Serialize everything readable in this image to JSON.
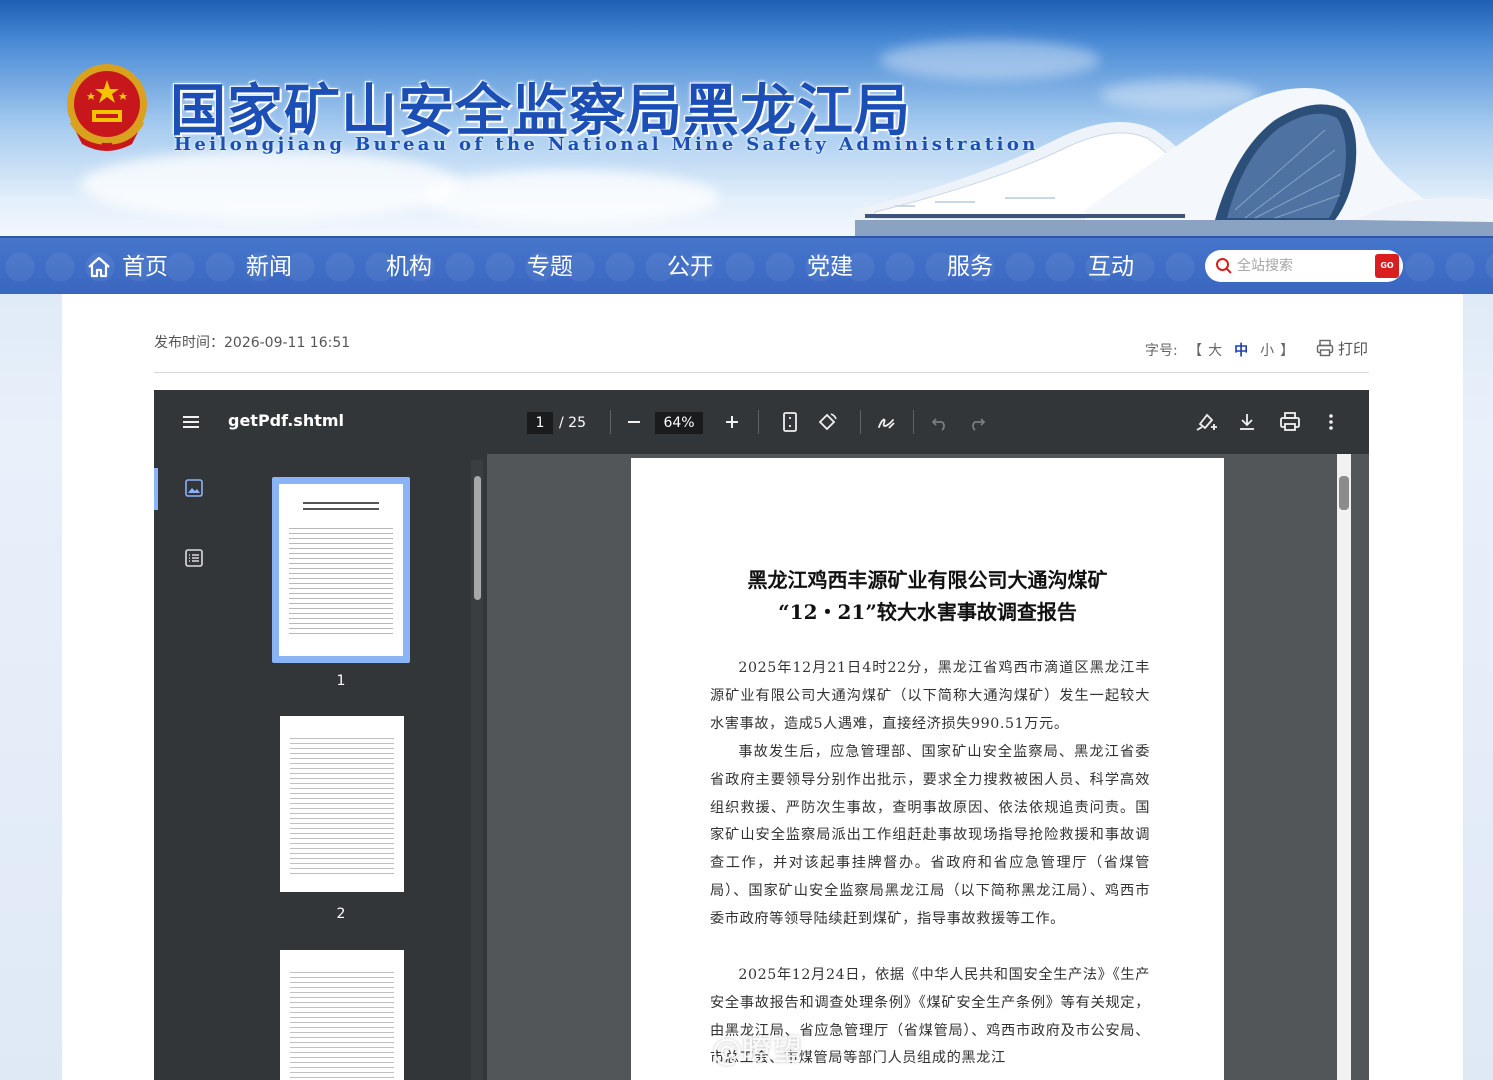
{
  "header": {
    "title": "国家矿山安全监察局黑龙江局",
    "subtitle": "Heilongjiang Bureau of the National Mine Safety Administration"
  },
  "nav": {
    "items": [
      "首页",
      "新闻",
      "机构",
      "专题",
      "公开",
      "党建",
      "服务",
      "互动"
    ],
    "search_placeholder": "全站搜索",
    "search_go": "GO"
  },
  "article": {
    "publish_time": "发布时间：2026-09-11 16:51",
    "font_size_label": "字号:",
    "font_size_open": "【",
    "font_size_close": "】",
    "font_sizes": [
      "大",
      "中",
      "小"
    ],
    "font_size_active": "中",
    "print_label": "打印"
  },
  "viewer": {
    "file_name": "getPdf.shtml",
    "current_page": "1",
    "total_pages": "/ 25",
    "zoom": "64%",
    "thumbnails": [
      "1",
      "2"
    ]
  },
  "document": {
    "title_line1": "黑龙江鸡西丰源矿业有限公司大通沟煤矿",
    "title_line2": "“12・21”较大水害事故调查报告",
    "para1": "2025年12月21日4时22分，黑龙江省鸡西市滴道区黑龙江丰源矿业有限公司大通沟煤矿（以下简称大通沟煤矿）发生一起较大水害事故，造成5人遇难，直接经济损失990.51万元。",
    "para2": "事故发生后，应急管理部、国家矿山安全监察局、黑龙江省委省政府主要领导分别作出批示，要求全力搜救被困人员、科学高效组织救援、严防次生事故，查明事故原因、依法依规追责问责。国家矿山安全监察局派出工作组赶赴事故现场指导抢险救援和事故调查工作，并对该起事挂牌督办。省政府和省应急管理厅（省煤管局）、国家矿山安全监察局黑龙江局（以下简称黑龙江局）、鸡西市委市政府等领导陆续赶到煤矿，指导事故救援等工作。",
    "para3": "2025年12月24日，依据《中华人民共和国安全生产法》《生产安全事故报告和调查处理条例》《煤矿安全生产条例》等有关规定，由黑龙江局、省应急管理厅（省煤管局）、鸡西市政府及市公安局、市总工会、市煤管局等部门人员组成的黑龙江"
  },
  "watermark": "@瞭望",
  "colors": {
    "nav_bg": "#3d6bc4",
    "title_blue": "#1b4fb5",
    "viewer_toolbar": "#323639",
    "viewer_bg": "#525659",
    "go_red": "#d81e1e"
  }
}
